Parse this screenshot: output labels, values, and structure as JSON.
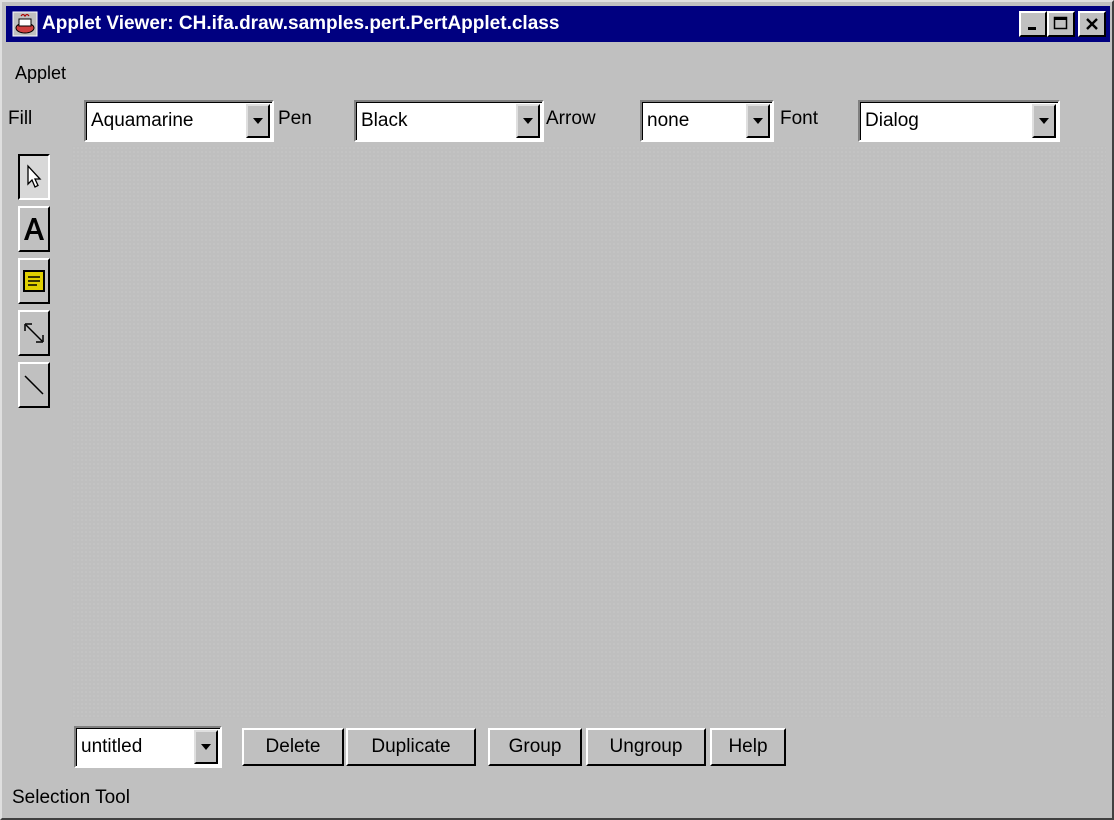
{
  "window": {
    "title": "Applet Viewer: CH.ifa.draw.samples.pert.PertApplet.class",
    "controls": [
      "minimize",
      "maximize",
      "close"
    ]
  },
  "menubar": {
    "items": [
      {
        "label": "Applet"
      }
    ]
  },
  "toolbar": {
    "fill_label": "Fill",
    "fill_value": "Aquamarine",
    "pen_label": "Pen",
    "pen_value": "Black",
    "arrow_label": "Arrow",
    "arrow_value": "none",
    "font_label": "Font",
    "font_value": "Dialog"
  },
  "tools": [
    {
      "name": "selection-tool",
      "icon": "pointer-arrow-icon",
      "selected": true
    },
    {
      "name": "text-tool",
      "icon": "text-a-icon"
    },
    {
      "name": "task-tool",
      "icon": "task-box-icon"
    },
    {
      "name": "dependency-tool",
      "icon": "diagonal-arrow-icon"
    },
    {
      "name": "line-tool",
      "icon": "diagonal-line-icon"
    }
  ],
  "bottombar": {
    "drawing_value": "untitled",
    "delete_label": "Delete",
    "duplicate_label": "Duplicate",
    "group_label": "Group",
    "ungroup_label": "Ungroup",
    "help_label": "Help"
  },
  "status": {
    "text": "Selection Tool"
  },
  "colors": {
    "title_bar": "#000080",
    "face": "#c0c0c0",
    "canvas": "#bfbfbf",
    "task_icon_fill": "#e0d000"
  }
}
